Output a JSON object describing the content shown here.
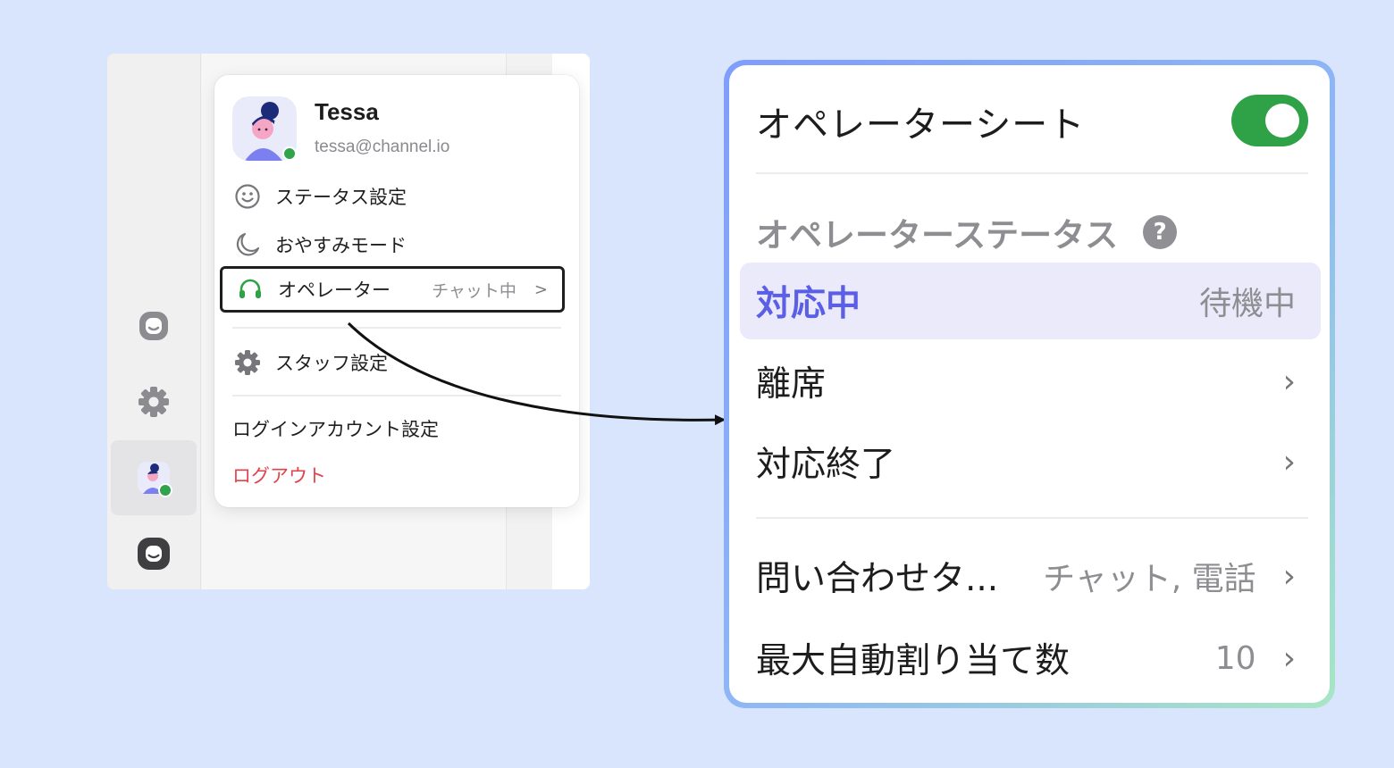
{
  "user": {
    "name": "Tessa",
    "email": "tessa@channel.io"
  },
  "menu": {
    "items": [
      {
        "label": "ステータス設定",
        "icon": "smiley-icon"
      },
      {
        "label": "おやすみモード",
        "icon": "moon-icon"
      }
    ],
    "operator": {
      "label": "オペレーター",
      "status": "チャット中",
      "icon": "headset-icon"
    },
    "staff_settings": "スタッフ設定",
    "login_account_settings": "ログインアカウント設定",
    "logout": "ログアウト"
  },
  "zoom_panel": {
    "title": "オペレーターシート",
    "toggle_on": true,
    "section_label": "オペレーターステータス",
    "help_icon_text": "?",
    "status_rows": [
      {
        "label": "対応中",
        "right": "待機中",
        "active": true
      },
      {
        "label": "離席",
        "chevron": "›"
      },
      {
        "label": "対応終了",
        "chevron": "›"
      }
    ],
    "settings_rows": [
      {
        "label": "問い合わせタ...",
        "value": "チャット, 電話",
        "chevron": "›"
      },
      {
        "label": "最大自動割り当て数",
        "value": "10",
        "chevron": "›"
      }
    ]
  },
  "colors": {
    "background": "#d9e5fd",
    "accent_green": "#2fa247",
    "active_purple": "#5a5fe6",
    "logout_red": "#e2434b"
  }
}
